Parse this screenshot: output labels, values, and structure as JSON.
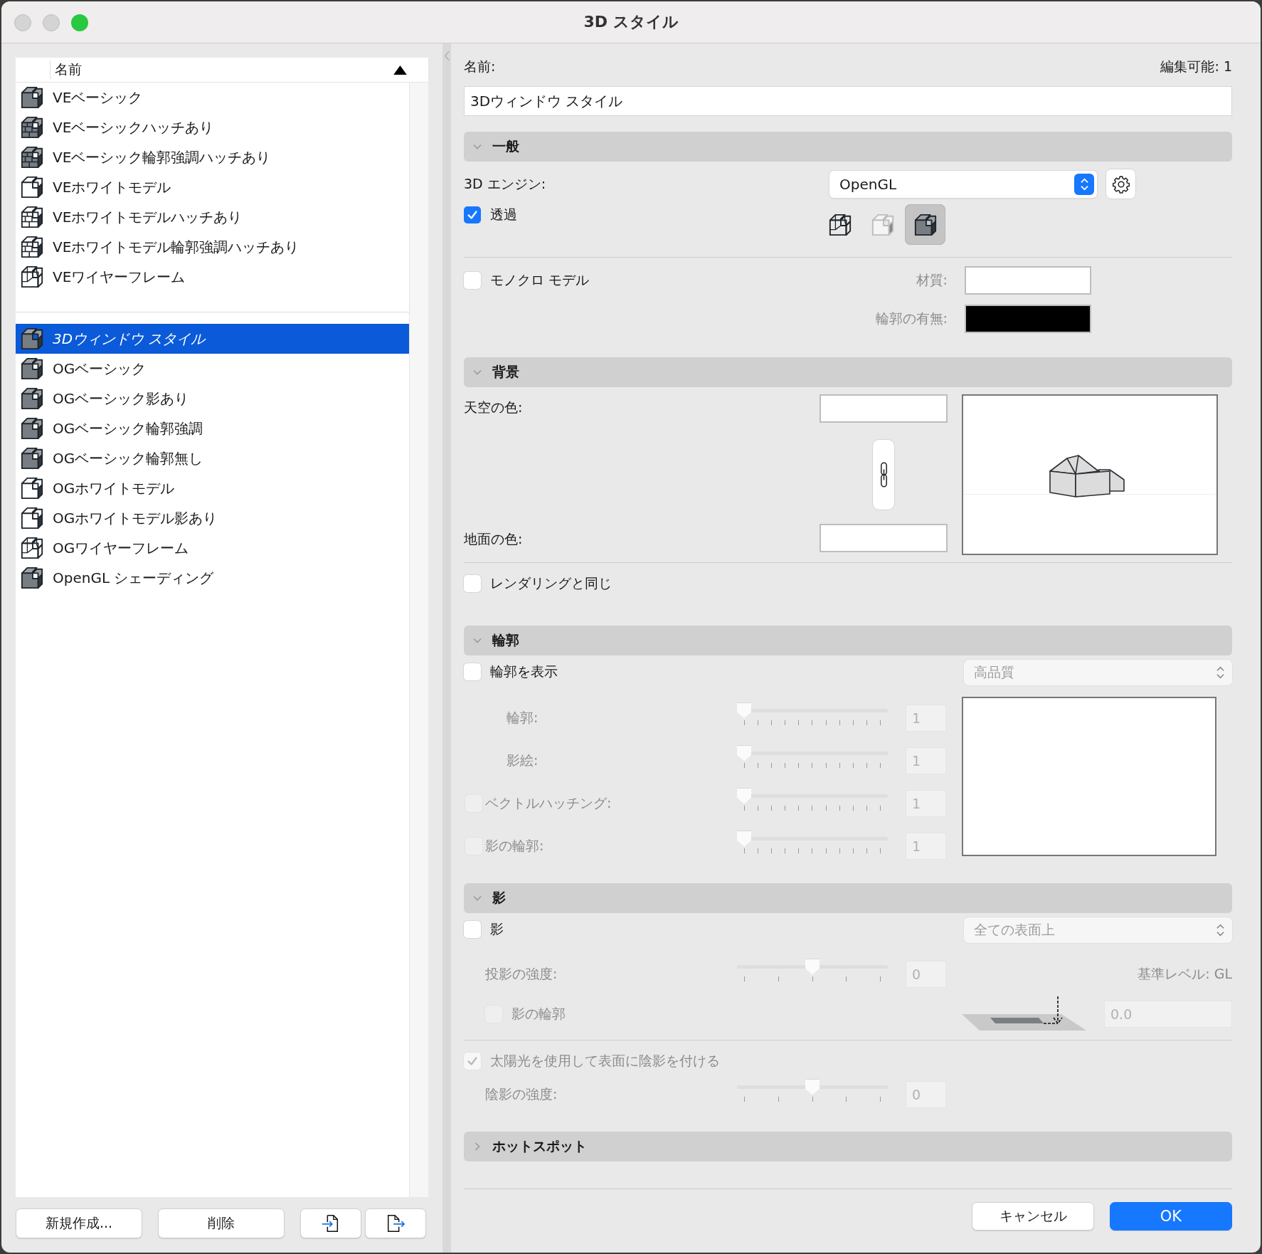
{
  "window": {
    "title": "3D スタイル"
  },
  "style_list": {
    "column_header": "名前",
    "groups": [
      {
        "items": [
          {
            "name": "VEベーシック",
            "kind": "solid",
            "selected": false,
            "current": false
          },
          {
            "name": "VEベーシックハッチあり",
            "kind": "hatched-solid",
            "selected": false,
            "current": false
          },
          {
            "name": "VEベーシック輪郭強調ハッチあり",
            "kind": "hatched-solid",
            "selected": false,
            "current": false
          },
          {
            "name": "VEホワイトモデル",
            "kind": "white",
            "selected": false,
            "current": false
          },
          {
            "name": "VEホワイトモデルハッチあり",
            "kind": "hatched-white",
            "selected": false,
            "current": false
          },
          {
            "name": "VEホワイトモデル輪郭強調ハッチあり",
            "kind": "hatched-white",
            "selected": false,
            "current": false
          },
          {
            "name": "VEワイヤーフレーム",
            "kind": "wireframe",
            "selected": false,
            "current": false
          }
        ]
      },
      {
        "items": [
          {
            "name": "3Dウィンドウ スタイル",
            "kind": "solid",
            "selected": true,
            "current": true
          },
          {
            "name": "OGベーシック",
            "kind": "solid",
            "selected": false,
            "current": false
          },
          {
            "name": "OGベーシック影あり",
            "kind": "solid",
            "selected": false,
            "current": false
          },
          {
            "name": "OGベーシック輪郭強調",
            "kind": "solid",
            "selected": false,
            "current": false
          },
          {
            "name": "OGベーシック輪郭無し",
            "kind": "solid",
            "selected": false,
            "current": false
          },
          {
            "name": "OGホワイトモデル",
            "kind": "white",
            "selected": false,
            "current": false
          },
          {
            "name": "OGホワイトモデル影あり",
            "kind": "white",
            "selected": false,
            "current": false
          },
          {
            "name": "OGワイヤーフレーム",
            "kind": "wireframe",
            "selected": false,
            "current": false
          },
          {
            "name": "OpenGL シェーディング",
            "kind": "solid",
            "selected": false,
            "current": false
          }
        ]
      }
    ]
  },
  "list_buttons": [
    {
      "kind": "text",
      "label": "新規作成..."
    },
    {
      "kind": "text",
      "label": "削除"
    },
    {
      "kind": "import"
    },
    {
      "kind": "export"
    }
  ],
  "name_field": {
    "label": "名前:",
    "value": "3Dウィンドウ スタイル",
    "editable_info": "編集可能: 1"
  },
  "general": {
    "title": "一般",
    "expanded": true,
    "engine_label": "3D エンジン:",
    "engine": "OpenGL",
    "transparency": {
      "label": "透過",
      "checked": true
    },
    "modes": [
      {
        "kind": "wireframe",
        "selected": false
      },
      {
        "kind": "white",
        "selected": false
      },
      {
        "kind": "solid",
        "selected": true
      }
    ],
    "monochrome": {
      "label": "モノクロ モデル",
      "checked": false
    },
    "material": {
      "label": "材質:",
      "color": "#ffffff"
    },
    "contour": {
      "label": "輪郭の有無:",
      "color": "#000000"
    }
  },
  "background": {
    "title": "背景",
    "expanded": true,
    "sky": {
      "label": "天空の色:",
      "color": "#ffffff"
    },
    "ground": {
      "label": "地面の色:",
      "color": "#ffffff"
    },
    "linked": true,
    "same_as_rendering": {
      "label": "レンダリングと同じ",
      "checked": false
    }
  },
  "contours": {
    "title": "輪郭",
    "expanded": true,
    "show": {
      "label": "輪郭を表示",
      "checked": false
    },
    "quality": {
      "value": "高品質",
      "disabled": true
    },
    "sliders": [
      {
        "kind": "plain",
        "label": "輪郭:",
        "level": 0,
        "value": "1",
        "disabled": true
      },
      {
        "kind": "plain",
        "label": "影絵:",
        "level": 0,
        "value": "1",
        "disabled": true
      },
      {
        "kind": "checkbox",
        "label": "ベクトルハッチング:",
        "checked": false,
        "level": 0,
        "value": "1",
        "disabled": true
      },
      {
        "kind": "checkbox",
        "label": "影の輪郭:",
        "checked": false,
        "level": 0,
        "value": "1",
        "disabled": true
      }
    ]
  },
  "shadows": {
    "title": "影",
    "expanded": true,
    "show": {
      "label": "影",
      "checked": false
    },
    "mode": {
      "value": "全ての表面上",
      "disabled": true
    },
    "cast_intensity": {
      "label": "投影の強度:",
      "level": 0.5,
      "value": "0",
      "disabled": true
    },
    "base_level": "基準レベル: GL",
    "shadow_contour": {
      "label": "影の輪郭",
      "checked": false,
      "disabled": true
    },
    "offset": {
      "value": "0.0",
      "disabled": true
    },
    "sun_shading": {
      "label": "太陽光を使用して表面に陰影を付ける",
      "checked": true,
      "disabled": true
    },
    "shade_intensity": {
      "label": "陰影の強度:",
      "level": 0.5,
      "value": "0",
      "disabled": true
    }
  },
  "hotspots": {
    "title": "ホットスポット",
    "expanded": false
  },
  "dialog_buttons": [
    {
      "kind": "cancel",
      "label": "キャンセル"
    },
    {
      "kind": "ok",
      "label": "OK"
    }
  ]
}
